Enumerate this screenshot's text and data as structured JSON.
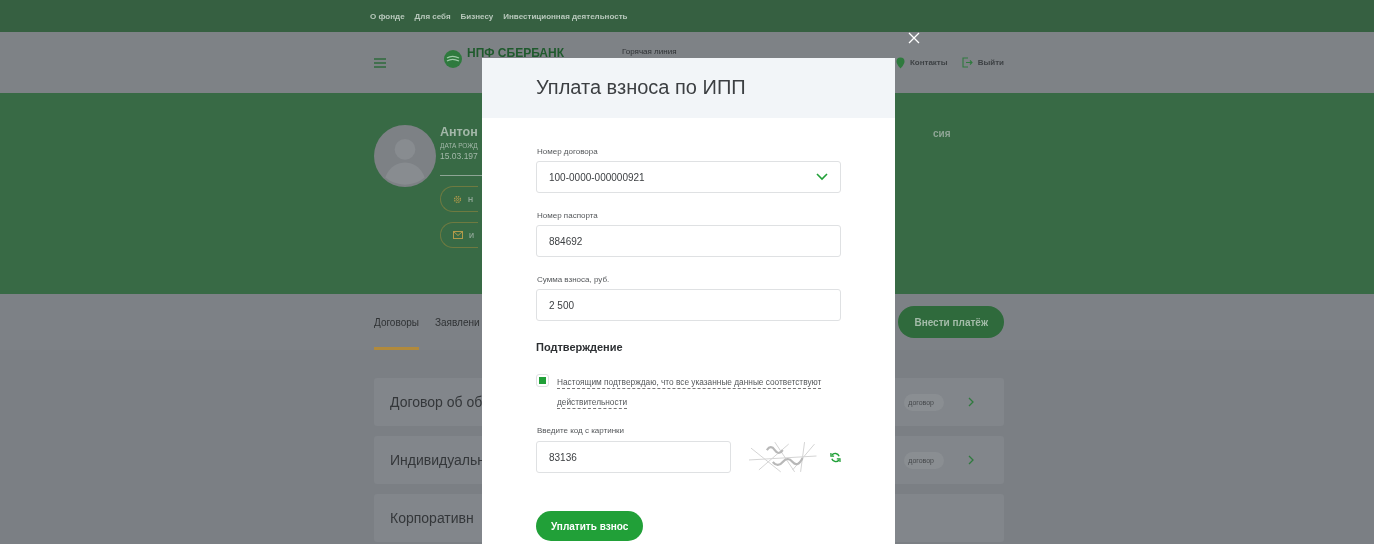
{
  "top_nav": {
    "links": [
      "О фонде",
      "Для себя",
      "Бизнесу",
      "Инвестиционная деятельность"
    ]
  },
  "header": {
    "logo": "НПФ СБЕРБАНК",
    "hotline": "Горячая линия",
    "actions": [
      {
        "kind": "contacts",
        "label": "Контакты"
      },
      {
        "kind": "logout",
        "label": "Выйти"
      }
    ]
  },
  "profile": {
    "name": "Антон",
    "dob_label": "ДАТА РОЖД",
    "dob": "15.03.197",
    "buttons": [
      {
        "kind": "settings",
        "label": "Н"
      },
      {
        "kind": "mail",
        "label": "И"
      }
    ],
    "column_3": "сия"
  },
  "tabs": [
    {
      "label": "Договоры",
      "selected": true
    },
    {
      "label": "Заявлени",
      "selected": false
    }
  ],
  "pay_button": "Внести платёж",
  "contracts": [
    {
      "title": "Договор об об",
      "badge": "договор"
    },
    {
      "title": "Индивидуальн",
      "badge": "договор"
    },
    {
      "title": "Корпоративн"
    }
  ],
  "modal": {
    "title": "Уплата взноса по ИПП",
    "fields": [
      {
        "kind": "select",
        "label": "Номер договора",
        "value": "100-0000-000000921"
      },
      {
        "kind": "input",
        "label": "Номер паспорта",
        "value": "884692"
      },
      {
        "kind": "input",
        "label": "Сумма взноса, руб.",
        "value": "2 500"
      }
    ],
    "confirmation": {
      "heading": "Подтверждение",
      "checked": true,
      "text": "Настоящим подтверждаю, что все указанные данные соответствуют действительности"
    },
    "captcha": {
      "label": "Введите код с картинки",
      "value": "83136"
    },
    "submit": "Уплатить взнос"
  }
}
